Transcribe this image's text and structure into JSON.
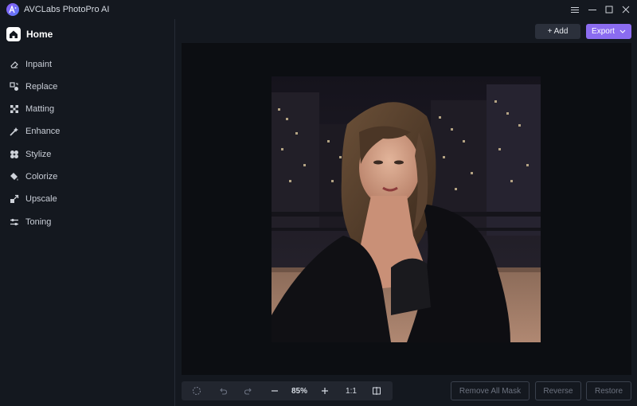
{
  "app": {
    "title": "AVCLabs PhotoPro AI"
  },
  "sidebar": {
    "home_label": "Home",
    "items": [
      {
        "label": "Inpaint",
        "icon": "eraser-icon"
      },
      {
        "label": "Replace",
        "icon": "replace-icon"
      },
      {
        "label": "Matting",
        "icon": "matting-icon"
      },
      {
        "label": "Enhance",
        "icon": "enhance-icon"
      },
      {
        "label": "Stylize",
        "icon": "stylize-icon"
      },
      {
        "label": "Colorize",
        "icon": "colorize-icon"
      },
      {
        "label": "Upscale",
        "icon": "upscale-icon"
      },
      {
        "label": "Toning",
        "icon": "toning-icon"
      }
    ]
  },
  "toolbar": {
    "add_label": "+ Add",
    "export_label": "Export"
  },
  "zoom": {
    "level": "85%",
    "actual_size": "1:1"
  },
  "actions": {
    "remove_all_mask": "Remove All Mask",
    "reverse": "Reverse",
    "restore": "Restore"
  },
  "colors": {
    "accent": "#8b6cf0",
    "background": "#14181f",
    "canvas": "#0c0e12"
  }
}
